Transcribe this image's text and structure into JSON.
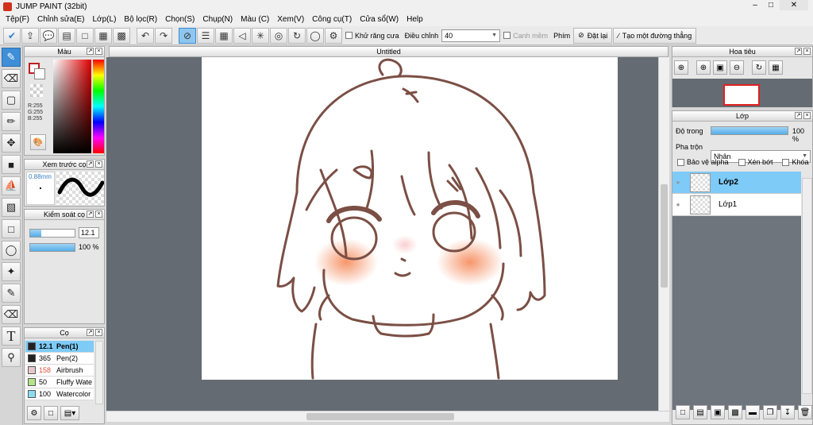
{
  "window": {
    "title": "JUMP PAINT (32bit)",
    "min": "–",
    "max": "□",
    "close": "✕"
  },
  "menu": [
    "Tệp(F)",
    "Chỉnh sửa(E)",
    "Lớp(L)",
    "Bộ lọc(R)",
    "Chọn(S)",
    "Chụp(N)",
    "Màu (C)",
    "Xem(V)",
    "Công cụ(T)",
    "Cửa sổ(W)",
    "Help"
  ],
  "toolbar": {
    "antialias_label": "Khử răng cưa",
    "adjust_label": "Điều chỉnh",
    "adjust_value": "40",
    "smooth_label": "Canh mềm",
    "key_label": "Phím",
    "reset_label": "Đặt lại",
    "straight_line_label": "Tạo một đường thẳng"
  },
  "document": {
    "tab_title": "Untitled"
  },
  "color_panel": {
    "title": "Màu",
    "r": "R:255",
    "g": "G:255",
    "b": "B:255"
  },
  "brush_preview_panel": {
    "title": "Xem trước cọ",
    "size": "0.88mm"
  },
  "brush_control_panel": {
    "title": "Kiểm soát cọ",
    "size_value": "12.1",
    "opacity_value": "100 %",
    "size_fraction": 0.25,
    "opacity_fraction": 1.0
  },
  "brush_panel": {
    "title": "Cọ",
    "brushes": [
      {
        "size": "12.1",
        "name": "Pen(1)",
        "color": "#222222",
        "selected": true
      },
      {
        "size": "365",
        "name": "Pen(2)",
        "color": "#222222",
        "selected": false
      },
      {
        "size": "158",
        "name": "Airbrush",
        "color": "#e6c8c8",
        "selected": false,
        "size_color": "#e0503c"
      },
      {
        "size": "50",
        "name": "Fluffy Wate",
        "color": "#b4e48c",
        "selected": false
      },
      {
        "size": "100",
        "name": "Watercolor",
        "color": "#8cdcf0",
        "selected": false
      }
    ]
  },
  "navigator_panel": {
    "title": "Hoa tiêu"
  },
  "layer_panel": {
    "title": "Lớp",
    "opacity_label": "Độ trong",
    "opacity_value": "100 %",
    "opacity_fraction": 1.0,
    "blend_label": "Pha trộn",
    "blend_value": "Nhân",
    "protect_alpha": "Bảo vệ alpha",
    "clip": "Xén bớt",
    "lock": "Khóa",
    "layers": [
      {
        "name": "Lớp2",
        "selected": true
      },
      {
        "name": "Lớp1",
        "selected": false
      }
    ]
  },
  "colors": {
    "accent": "#3e8ed8",
    "selection": "#7ecbf7",
    "line_art": "#7b4f45",
    "blush": "#f58a5a",
    "canvas_bg": "#646b72"
  }
}
